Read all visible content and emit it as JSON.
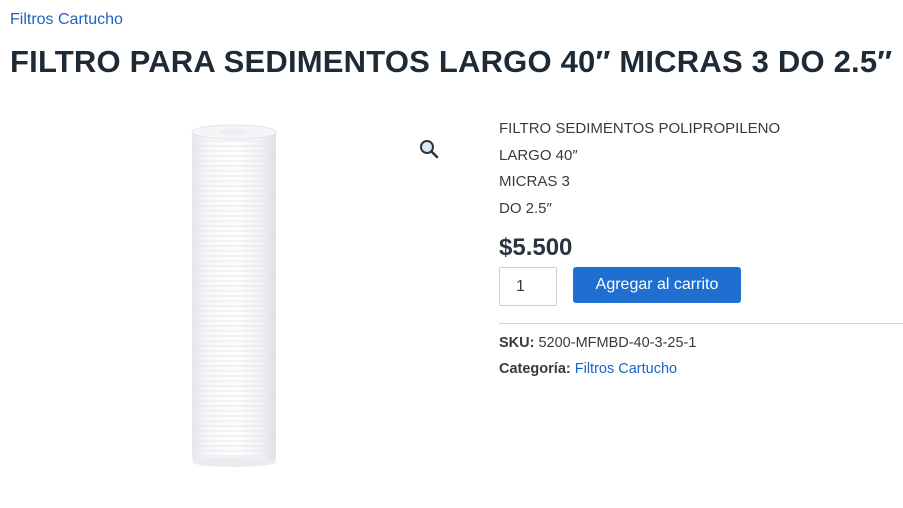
{
  "breadcrumb": {
    "label": "Filtros Cartucho"
  },
  "product": {
    "title": "FILTRO PARA SEDIMENTOS LARGO 40″ MICRAS 3 DO 2.5″",
    "description_lines": [
      "FILTRO SEDIMENTOS POLIPROPILENO",
      "LARGO 40″",
      "MICRAS 3",
      "DO 2.5″"
    ],
    "price": "$5.500",
    "quantity": "1",
    "add_to_cart_label": "Agregar al carrito",
    "sku_label": "SKU:",
    "sku_value": "5200-MFMBD-40-3-25-1",
    "category_label": "Categoría:",
    "category_value": "Filtros Cartucho"
  },
  "icons": {
    "zoom": "magnifier-icon",
    "product_image": "white-sediment-filter-cartridge"
  },
  "colors": {
    "link": "#1e63c4",
    "button": "#1e6fd0",
    "title": "#1f2a37"
  }
}
